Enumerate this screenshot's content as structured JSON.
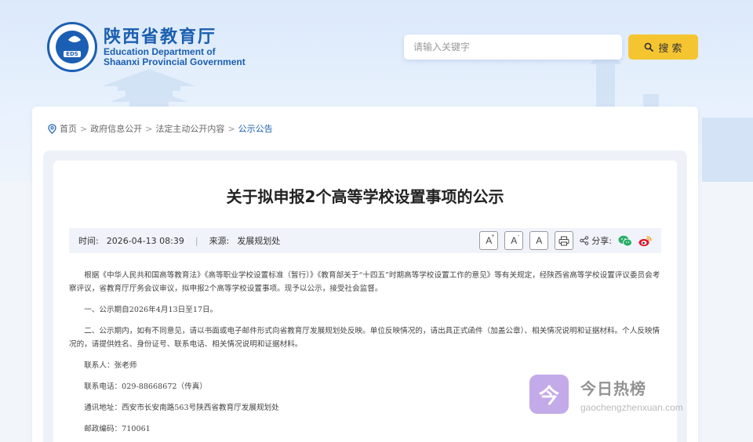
{
  "header": {
    "seal_tag": "EDS",
    "logo_cn": "陕西省教育厅",
    "logo_en_line1": "Education Department of",
    "logo_en_line2": "Shaanxi Provincial Government",
    "search_placeholder": "请输入关键字",
    "search_button": "搜 索"
  },
  "breadcrumb": {
    "items": [
      "首页",
      "政府信息公开",
      "法定主动公开内容"
    ],
    "current": "公示公告",
    "sep": ">"
  },
  "article": {
    "title": "关于拟申报2个高等学校设置事项的公示",
    "time_label": "时间:",
    "time_value": "2026-04-13 08:39",
    "divider": "|",
    "source_label": "来源:",
    "source_value": "发展规划处",
    "font_large": "A",
    "font_medium": "A",
    "font_small": "A",
    "share_label": "分享:",
    "paragraphs": [
      "根据《中华人民共和国高等教育法》《高等职业学校设置标准（暂行）》《教育部关于“十四五”时期高等学校设置工作的意见》等有关规定，经陕西省高等学校设置评议委员会考察评议，省教育厅厅务会议审议，拟申报2个高等学校设置事项。现予以公示，接受社会监督。",
      "一、公示期自2026年4月13日至17日。",
      "二、公示期内，如有不同意见，请以书面或电子邮件形式向省教育厅发展规划处反映。单位反映情况的，请出具正式函件（加盖公章）、相关情况说明和证据材料。个人反映情况的，请提供姓名、身份证号、联系电话、相关情况说明和证据材料。",
      "联系人：张老师",
      "联系电话：029-88668672（传真）",
      "通讯地址：西安市长安南路563号陕西省教育厅发展规划处",
      "邮政编码：710061"
    ]
  },
  "watermark": {
    "glyph": "今",
    "cn": "今日热榜",
    "en": "gaochengzhenxuan.com"
  },
  "colors": {
    "brand_blue": "#1a5fb0",
    "search_button": "#f5c531",
    "wechat": "#2aae67",
    "weibo": "#e6162d"
  }
}
